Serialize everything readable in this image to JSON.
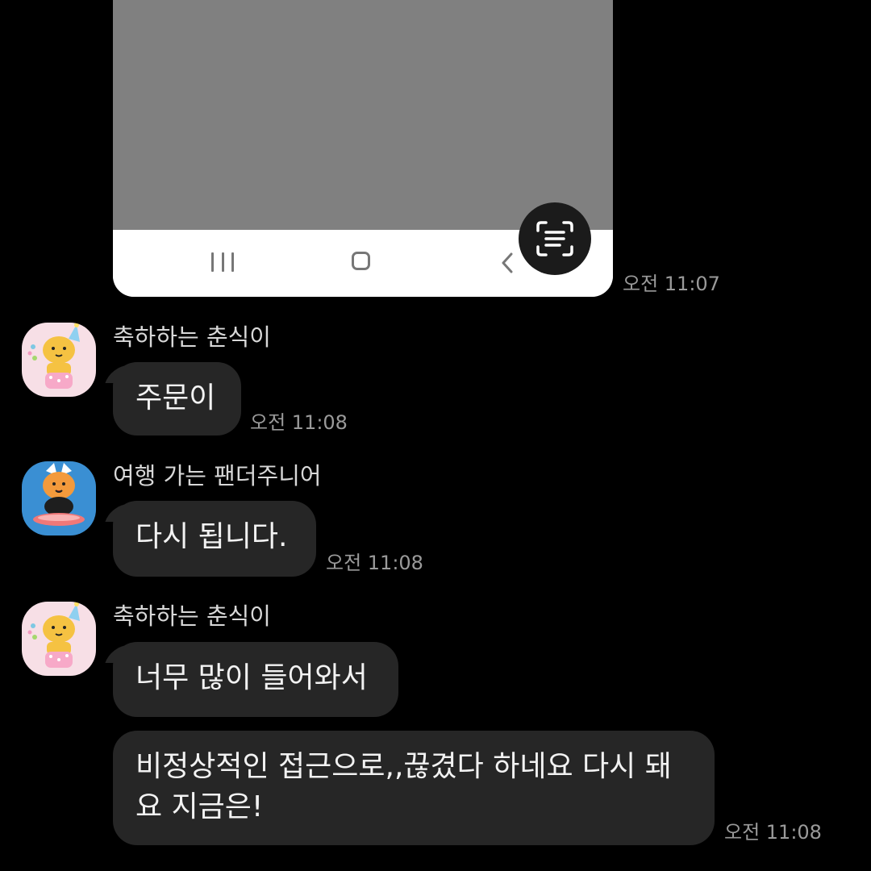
{
  "shared_image": {
    "time": "오전 11:07",
    "nav_icons": [
      "recents-icon",
      "home-icon",
      "back-icon"
    ],
    "overlay_button_icon": "text-scan-icon"
  },
  "messages": [
    {
      "sender": "축하하는 춘식이",
      "avatar_icon": "party-hat-cat-icon",
      "text": "주문이",
      "time": "오전 11:08"
    },
    {
      "sender": "여행 가는 팬더주니어",
      "avatar_icon": "surfing-panda-icon",
      "text": "다시 됩니다.",
      "time": "오전 11:08"
    },
    {
      "sender": "축하하는 춘식이",
      "avatar_icon": "party-hat-cat-icon",
      "text": "너무 많이 들어와서",
      "time": ""
    },
    {
      "sender": "",
      "text": "비정상적인 접근으로,,끊겼다 하네요 다시 돼\n요 지금은!",
      "time": "오전 11:08"
    }
  ],
  "colors": {
    "background": "#000000",
    "bubble": "#262626",
    "bubble_text": "#f2f2f2",
    "sender_text": "#d8d8d8",
    "time_text": "#9a9a9a"
  }
}
